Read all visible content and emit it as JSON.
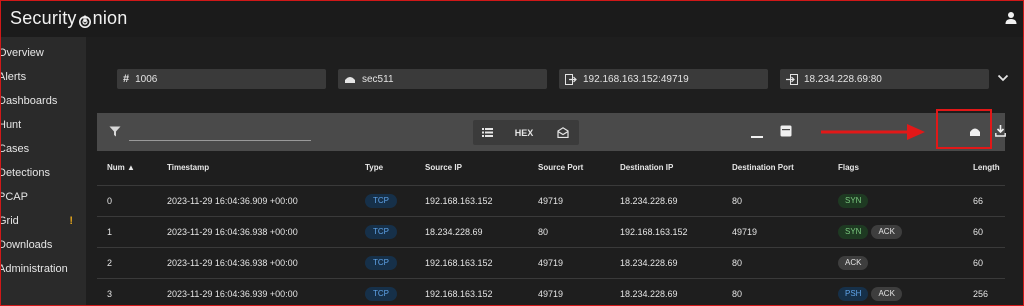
{
  "app": {
    "brand_left": "Security",
    "brand_right": "nion",
    "logo_icon": "onion-logo-icon",
    "user_icon": "user-icon"
  },
  "sidebar": {
    "items": [
      {
        "label": "Overview"
      },
      {
        "label": "Alerts"
      },
      {
        "label": "Dashboards"
      },
      {
        "label": "Hunt"
      },
      {
        "label": "Cases"
      },
      {
        "label": "Detections"
      },
      {
        "label": "PCAP"
      },
      {
        "label": "Grid",
        "badge": "!"
      },
      {
        "label": "Downloads"
      },
      {
        "label": "Administration"
      }
    ]
  },
  "chips": {
    "job_id": "1006",
    "sensor": "sec511",
    "source": "192.168.163.152:49719",
    "destination": "18.234.228.69:80"
  },
  "toolbar": {
    "filter_placeholder": "",
    "hex_label": "HEX",
    "icons": [
      "filter-icon",
      "list-icon",
      "mail-open-icon",
      "minimize-icon",
      "window-icon",
      "wireshark-icon",
      "download-icon"
    ]
  },
  "table": {
    "headers": [
      "Num",
      "Timestamp",
      "Type",
      "Source IP",
      "Source Port",
      "Destination IP",
      "Destination Port",
      "Flags",
      "Length"
    ],
    "sort_indicator": "▲",
    "rows": [
      {
        "num": "0",
        "timestamp": "2023-11-29 16:04:36.909 +00:00",
        "type": "TCP",
        "src_ip": "192.168.163.152",
        "src_port": "49719",
        "dst_ip": "18.234.228.69",
        "dst_port": "80",
        "flags": [
          "SYN"
        ],
        "length": "66"
      },
      {
        "num": "1",
        "timestamp": "2023-11-29 16:04:36.938 +00:00",
        "type": "TCP",
        "src_ip": "18.234.228.69",
        "src_port": "80",
        "dst_ip": "192.168.163.152",
        "dst_port": "49719",
        "flags": [
          "SYN",
          "ACK"
        ],
        "length": "60"
      },
      {
        "num": "2",
        "timestamp": "2023-11-29 16:04:36.938 +00:00",
        "type": "TCP",
        "src_ip": "192.168.163.152",
        "src_port": "49719",
        "dst_ip": "18.234.228.69",
        "dst_port": "80",
        "flags": [
          "ACK"
        ],
        "length": "60"
      },
      {
        "num": "3",
        "timestamp": "2023-11-29 16:04:36.939 +00:00",
        "type": "TCP",
        "src_ip": "192.168.163.152",
        "src_port": "49719",
        "dst_ip": "18.234.228.69",
        "dst_port": "80",
        "flags": [
          "PSH",
          "ACK"
        ],
        "length": "256"
      }
    ]
  },
  "colors": {
    "accent_red": "#e21818",
    "tcp_blue": "#5fa3e8",
    "syn_green": "#7bc97f",
    "warn_orange": "#e0a21c"
  }
}
